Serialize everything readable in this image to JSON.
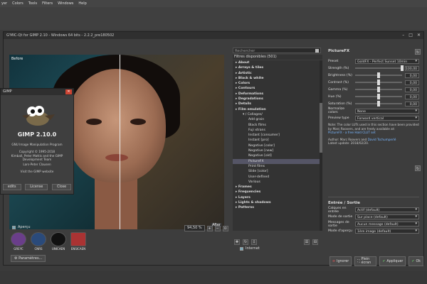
{
  "menubar": [
    "yer",
    "Colors",
    "Tools",
    "Filters",
    "Windows",
    "Help"
  ],
  "gmic": {
    "title": "G'MIC-Qt for GIMP 2.10 - Windows 64 bits - 2.2.2_pre180502",
    "before": "Before",
    "after": "After",
    "apercu": "Aperçu",
    "zoom": "94,50 %",
    "params_button": "Paramètres...",
    "logos": [
      "GREYC",
      "CNRS",
      "UNICAEN",
      "ENSICAEN"
    ]
  },
  "filters": {
    "search_placeholder": "Rechercher",
    "header": "Filtres disponibles (501)",
    "items": [
      {
        "label": "About",
        "type": "cat"
      },
      {
        "label": "Arrays & tiles",
        "type": "cat"
      },
      {
        "label": "Artistic",
        "type": "cat"
      },
      {
        "label": "Black & white",
        "type": "cat"
      },
      {
        "label": "Colors",
        "type": "cat"
      },
      {
        "label": "Contours",
        "type": "cat"
      },
      {
        "label": "Deformations",
        "type": "cat"
      },
      {
        "label": "Degradations",
        "type": "cat"
      },
      {
        "label": "Details",
        "type": "cat"
      },
      {
        "label": "Film emulation",
        "type": "cat"
      },
      {
        "label": "/ Collages/",
        "type": "subcat"
      },
      {
        "label": "Add grain",
        "type": "sub"
      },
      {
        "label": "Black films",
        "type": "sub"
      },
      {
        "label": "Fuji xtrans",
        "type": "sub"
      },
      {
        "label": "Instant [consumer]",
        "type": "sub"
      },
      {
        "label": "Instant [pro]",
        "type": "sub"
      },
      {
        "label": "Negative [color]",
        "type": "sub"
      },
      {
        "label": "Negative [new]",
        "type": "sub"
      },
      {
        "label": "Negative [old]",
        "type": "sub"
      },
      {
        "label": "PictureFX",
        "type": "sub",
        "selected": true
      },
      {
        "label": "Print films",
        "type": "sub"
      },
      {
        "label": "Slide [color]",
        "type": "sub"
      },
      {
        "label": "User-defined",
        "type": "sub"
      },
      {
        "label": "Various",
        "type": "sub"
      },
      {
        "label": "Frames",
        "type": "cat"
      },
      {
        "label": "Frequencies",
        "type": "cat"
      },
      {
        "label": "Layers",
        "type": "cat"
      },
      {
        "label": "Lights & shadows",
        "type": "cat"
      },
      {
        "label": "Patterns",
        "type": "cat"
      }
    ],
    "internet_label": "Internet"
  },
  "params": {
    "title": "PictureFX",
    "preset_label": "Preset",
    "preset_value": "GoldFX - Perfect Sunset 10min",
    "sliders": [
      {
        "label": "Strength (%)",
        "value": "100,00",
        "fraction": 1.0
      },
      {
        "label": "Brightness (%)",
        "value": "0,00",
        "fraction": 0.5
      },
      {
        "label": "Contrast (%)",
        "value": "0,00",
        "fraction": 0.5
      },
      {
        "label": "Gamma (%)",
        "value": "0,00",
        "fraction": 0.5
      },
      {
        "label": "Hue (%)",
        "value": "0,00",
        "fraction": 0.5
      },
      {
        "label": "Saturation (%)",
        "value": "0,00",
        "fraction": 0.5
      }
    ],
    "normalize_label": "Normalize colors",
    "normalize_value": "None",
    "preview_type_label": "Preview type",
    "preview_type_value": "Forward vertical",
    "note": "Note: The color LUTs used in this section have been provided by Marc Roovers, and are freely available at:",
    "note_link": "PictureFX - a free Hald CLUT set",
    "author": "Author: Marc Roovers and",
    "author_link": "David Tschumperlé",
    "latest_update": "Latest update: 2018/02/20."
  },
  "io": {
    "title": "Entrée / Sortie",
    "rows": [
      {
        "label": "Calques en entrée",
        "value": "Actif (default)"
      },
      {
        "label": "Mode de sortie",
        "value": "Sur place (default)"
      },
      {
        "label": "Messages de sortie",
        "value": "Aucun message (default)"
      },
      {
        "label": "Mode d'aperçu",
        "value": "1ère image (default)"
      }
    ]
  },
  "buttons": {
    "ignore": "Ignorer",
    "fullscreen": "Plein écran",
    "apply": "Appliquer",
    "ok": "Ok"
  },
  "about": {
    "title": "GIMP",
    "version": "GIMP 2.10.0",
    "subtitle": "GNU Image Manipulation Program",
    "copyright": "Copyright © 1995-2018",
    "authors": "Kimball, Peter Mattis and the GIMP Development Team",
    "credit": "Lars-Peter Clausen",
    "visit": "Visit the GIMP website",
    "btn_credits": "edits",
    "btn_license": "License",
    "btn_close": "Close"
  }
}
